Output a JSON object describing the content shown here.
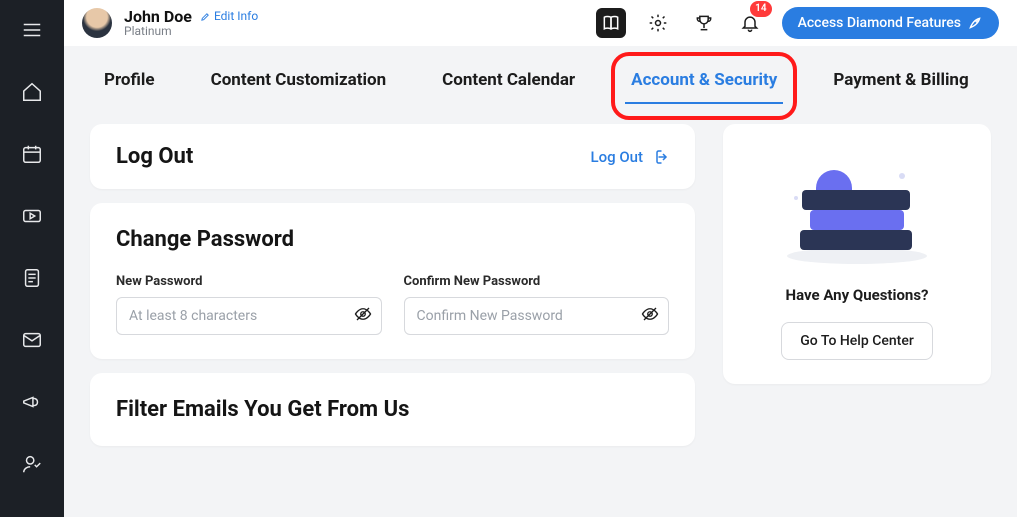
{
  "user": {
    "name": "John Doe",
    "tier": "Platinum",
    "edit_label": "Edit Info"
  },
  "header": {
    "cta": "Access Diamond Features",
    "notification_count": "14"
  },
  "tabs": {
    "profile": "Profile",
    "customization": "Content Customization",
    "calendar": "Content Calendar",
    "account": "Account & Security",
    "payment": "Payment & Billing"
  },
  "logout": {
    "heading": "Log Out",
    "link": "Log Out"
  },
  "password": {
    "heading": "Change Password",
    "new_label": "New Password",
    "new_placeholder": "At least 8 characters",
    "confirm_label": "Confirm New Password",
    "confirm_placeholder": "Confirm New Password"
  },
  "emails": {
    "heading": "Filter Emails You Get From Us"
  },
  "help": {
    "question": "Have Any Questions?",
    "button": "Go To Help Center"
  }
}
